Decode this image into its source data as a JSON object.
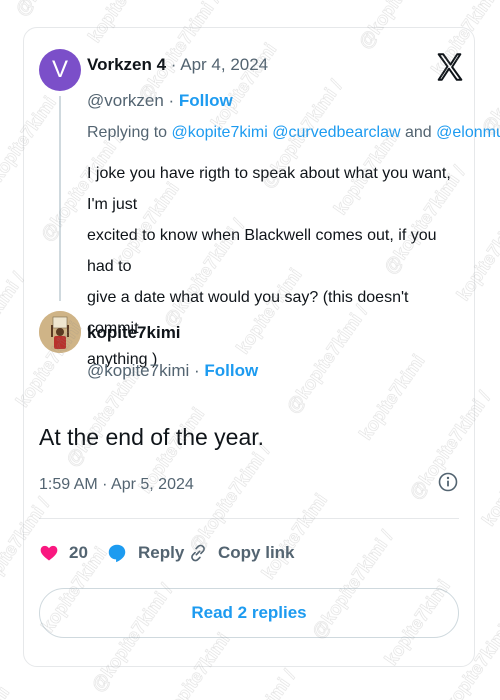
{
  "original_tweet": {
    "avatar_letter": "V",
    "display_name": "Vorkzen 4",
    "date": "Apr 4, 2024",
    "handle": "@vorkzen",
    "follow_label": "Follow",
    "replying_prefix": "Replying to",
    "mention_1": "@kopite7kimi",
    "mention_2": "@curvedbearclaw",
    "mention_joiner": "and",
    "mention_3": "@elonmusk",
    "body_line_1": "I joke you have rigth to speak about what you want, I'm just",
    "body_line_2": "excited to know when Blackwell comes out, if you had to",
    "body_line_3": "give a date what would you say? (this doesn't commit",
    "body_line_4": "anything )"
  },
  "reply_tweet": {
    "display_name": "kopite7kimi",
    "handle": "@kopite7kimi",
    "follow_label": "Follow",
    "text": "At the end of the year.",
    "timestamp": "1:59 AM · Apr 5, 2024"
  },
  "actions": {
    "like_count": "20",
    "reply_label": "Reply",
    "copy_link_label": "Copy link"
  },
  "read_replies_label": "Read 2 replies",
  "watermark_text": "@kopite7kimi / kopite7kimi.com / @kopite7kimi",
  "colors": {
    "accent": "#1d9bf0",
    "like": "#f91880",
    "avatar_v": "#7b4fc9",
    "muted": "#536471"
  }
}
